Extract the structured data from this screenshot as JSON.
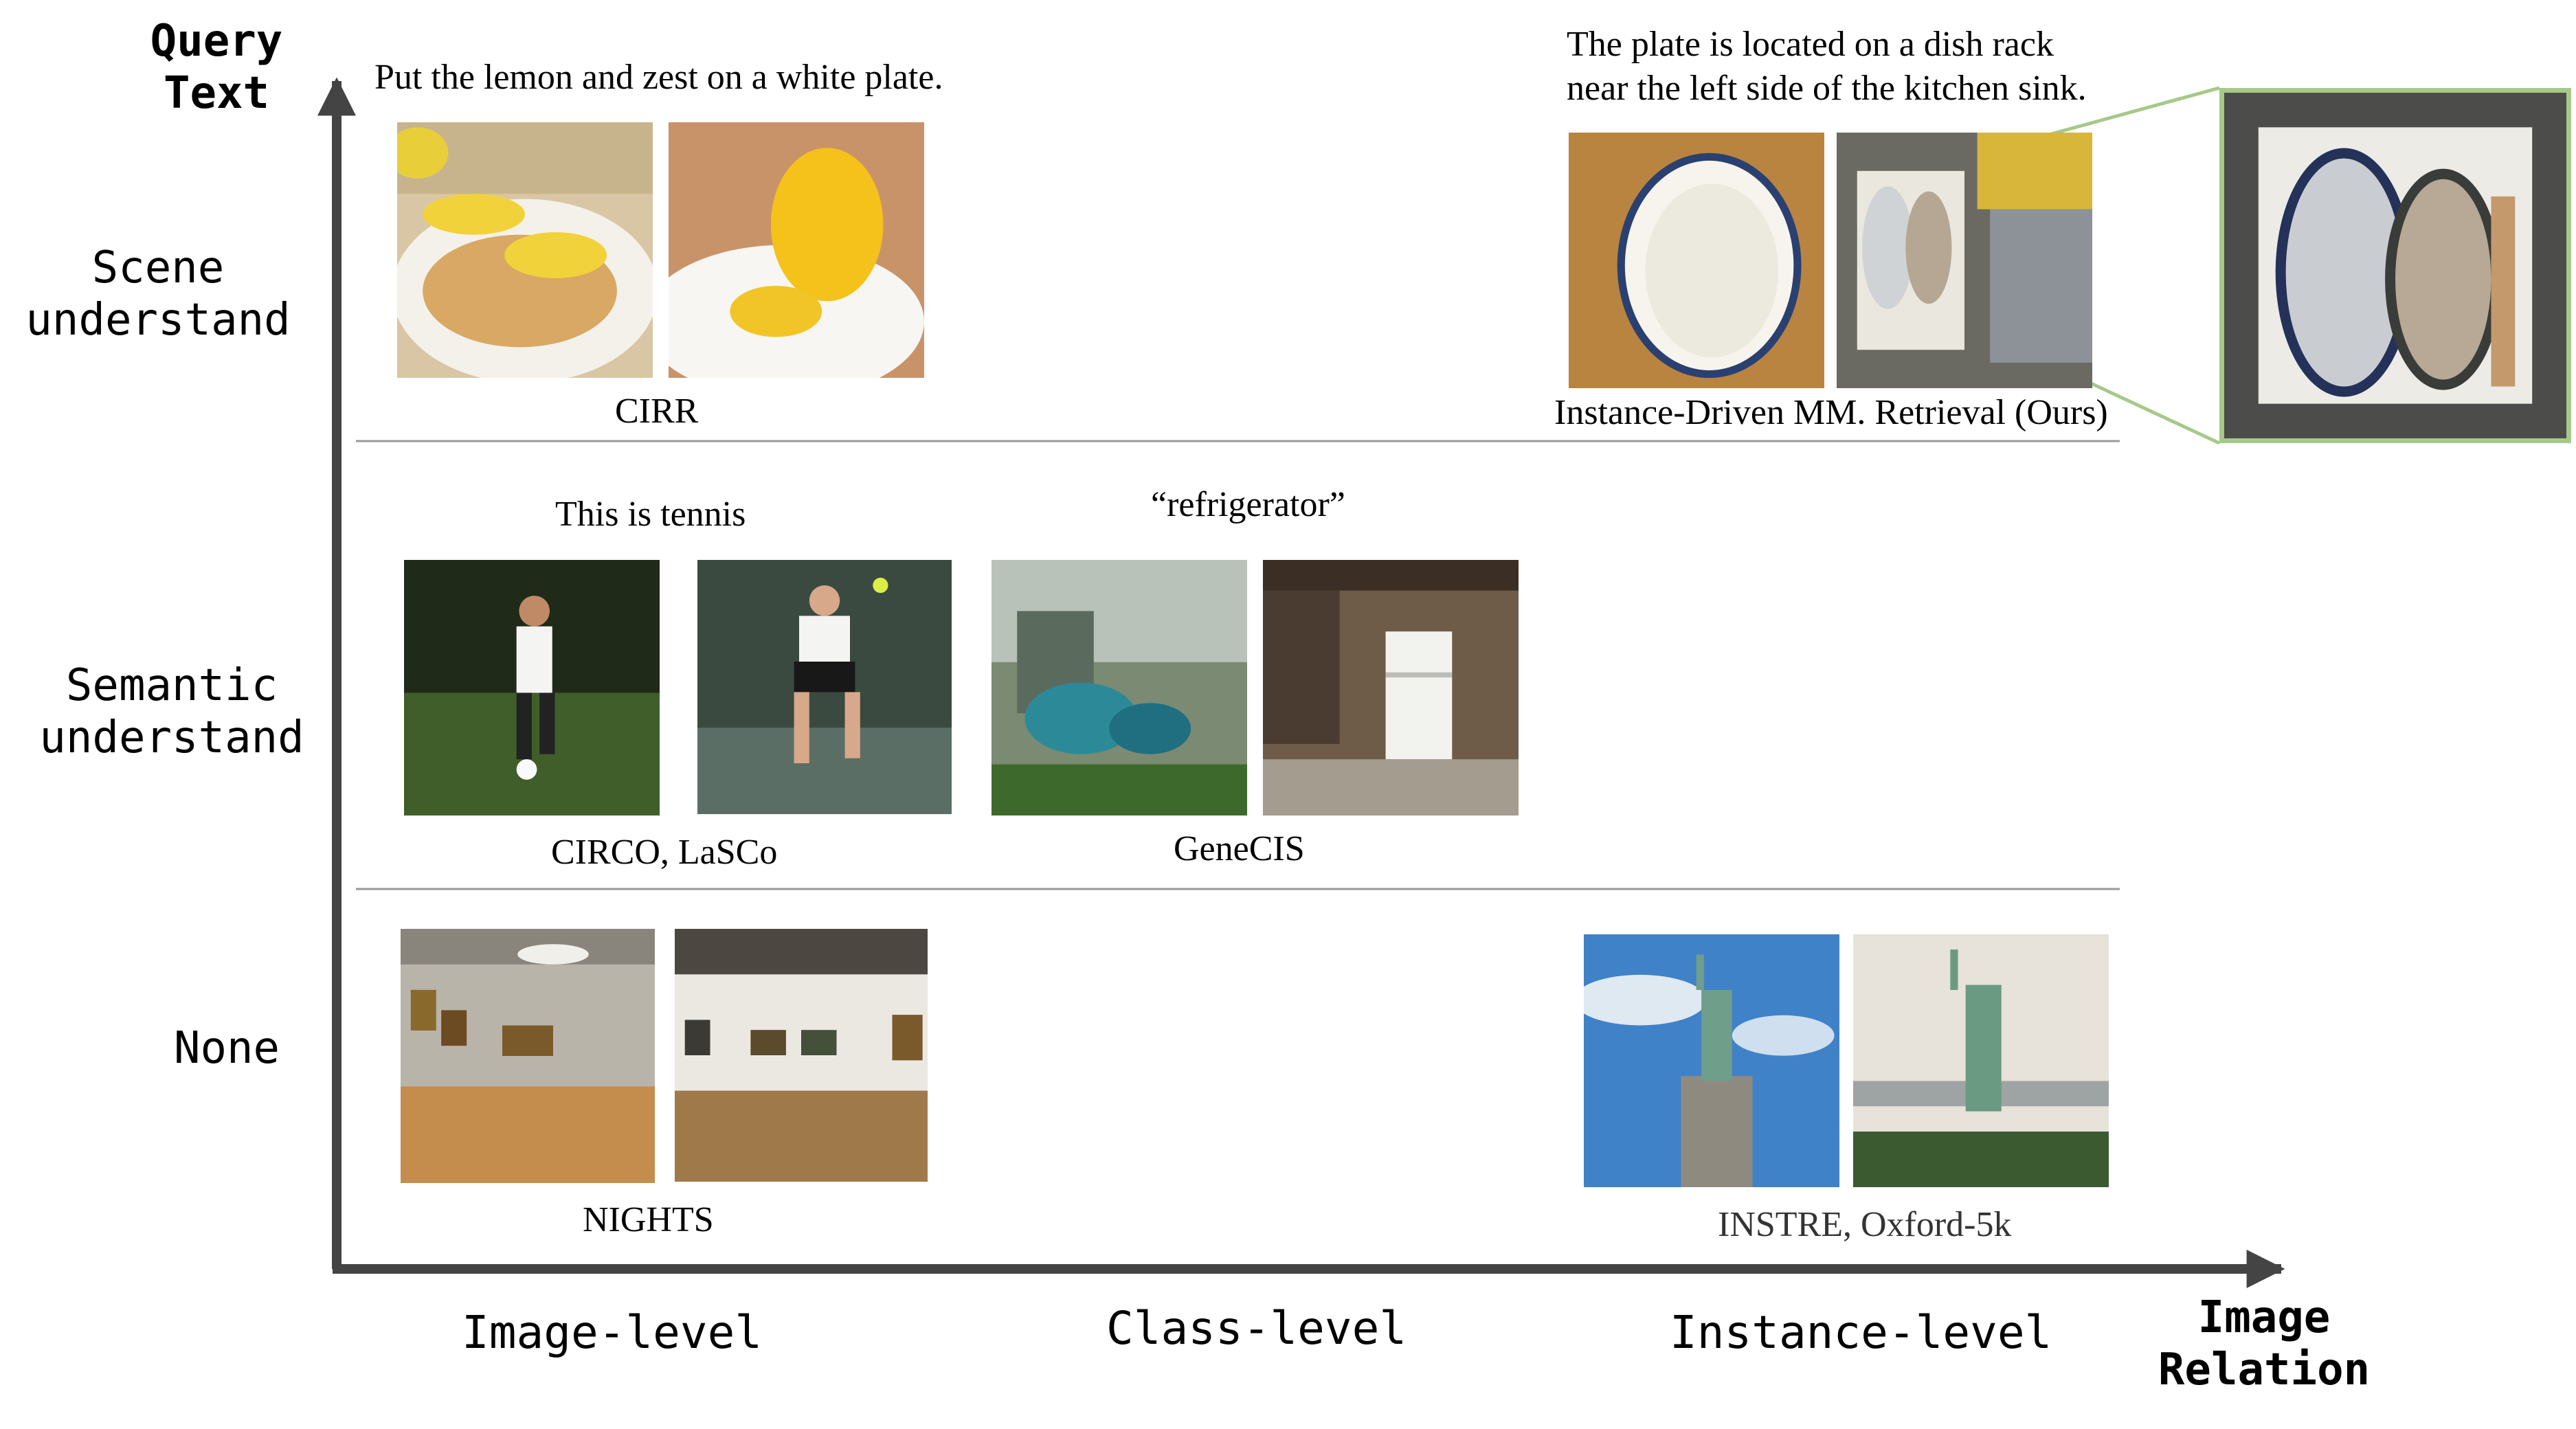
{
  "y_axis": {
    "title": "Query Text"
  },
  "x_axis": {
    "title": "Image Relation"
  },
  "rows": [
    {
      "label": "Scene understand"
    },
    {
      "label": "Semantic understand"
    },
    {
      "label": "None"
    }
  ],
  "columns": [
    {
      "label": "Image-level"
    },
    {
      "label": "Class-level"
    },
    {
      "label": "Instance-level"
    }
  ],
  "examples": {
    "cirr": {
      "query": "Put the lemon and zest on a white plate.",
      "dataset": "CIRR"
    },
    "ours": {
      "query_line1": "The plate is located on a dish rack",
      "query_line2": "near the left side of the kitchen sink.",
      "dataset": "Instance-Driven MM. Retrieval (Ours)"
    },
    "circo": {
      "query": "This is tennis",
      "dataset": "CIRCO, LaSCo"
    },
    "genecis": {
      "query": "“refrigerator”",
      "dataset": "GeneCIS"
    },
    "nights": {
      "dataset": "NIGHTS"
    },
    "instre": {
      "dataset": "INSTRE, Oxford-5k"
    }
  },
  "colors": {
    "axis": "#444444",
    "divider": "#999999",
    "zoom_highlight": "#a6c98a"
  },
  "icons": [
    "lemon-plate-photo",
    "lemon-zest-photo",
    "white-plate-photo",
    "dish-rack-photo",
    "soccer-player-photo",
    "tennis-player-photo",
    "yard-debris-photo",
    "refrigerator-photo",
    "gallery-photo",
    "statue-of-liberty-photo"
  ]
}
